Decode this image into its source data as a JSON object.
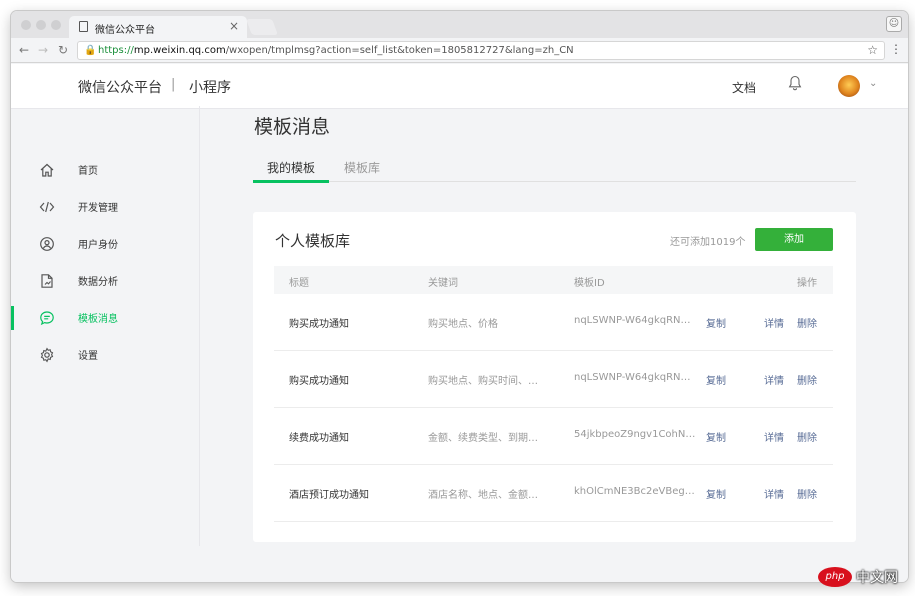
{
  "browser": {
    "tab_title": "微信公众平台",
    "tab_close": "×",
    "url_scheme": "https://",
    "url_host": "mp.weixin.qq.com",
    "url_path": "/wxopen/tmplmsg?action=self_list&token=1805812727&lang=zh_CN"
  },
  "header": {
    "brand": "微信公众平台",
    "separator": "|",
    "product": "小程序",
    "doc_link": "文档"
  },
  "sidebar": {
    "items": [
      {
        "label": "首页",
        "icon": "home-icon"
      },
      {
        "label": "开发管理",
        "icon": "code-icon"
      },
      {
        "label": "用户身份",
        "icon": "user-icon"
      },
      {
        "label": "数据分析",
        "icon": "chart-doc-icon"
      },
      {
        "label": "模板消息",
        "icon": "message-icon",
        "active": true
      },
      {
        "label": "设置",
        "icon": "gear-icon"
      }
    ]
  },
  "main": {
    "title": "模板消息",
    "tabs": [
      {
        "label": "我的模板",
        "active": true
      },
      {
        "label": "模板库",
        "active": false
      }
    ],
    "card": {
      "title": "个人模板库",
      "quota": "还可添加1019个",
      "add_label": "添加",
      "columns": {
        "title": "标题",
        "keywords": "关键词",
        "template_id": "模板ID",
        "actions": "操作"
      },
      "rows": [
        {
          "title": "购买成功通知",
          "keywords": "购买地点、价格",
          "template_id": "nqLSWNP-W64gkqRN…",
          "copy": "复制",
          "detail": "详情",
          "delete": "删除"
        },
        {
          "title": "购买成功通知",
          "keywords": "购买地点、购买时间、…",
          "template_id": "nqLSWNP-W64gkqRN…",
          "copy": "复制",
          "detail": "详情",
          "delete": "删除"
        },
        {
          "title": "续费成功通知",
          "keywords": "金额、续费类型、到期…",
          "template_id": "54jkbpeoZ9ngv1CohN…",
          "copy": "复制",
          "detail": "详情",
          "delete": "删除"
        },
        {
          "title": "酒店预订成功通知",
          "keywords": "酒店名称、地点、金额…",
          "template_id": "khOlCmNE3Bc2eVBeg…",
          "copy": "复制",
          "detail": "详情",
          "delete": "删除"
        }
      ]
    }
  },
  "watermark": {
    "badge": "php",
    "text": "中文网"
  },
  "colors": {
    "accent": "#07c160",
    "button": "#34b03a",
    "link": "#576b95"
  }
}
